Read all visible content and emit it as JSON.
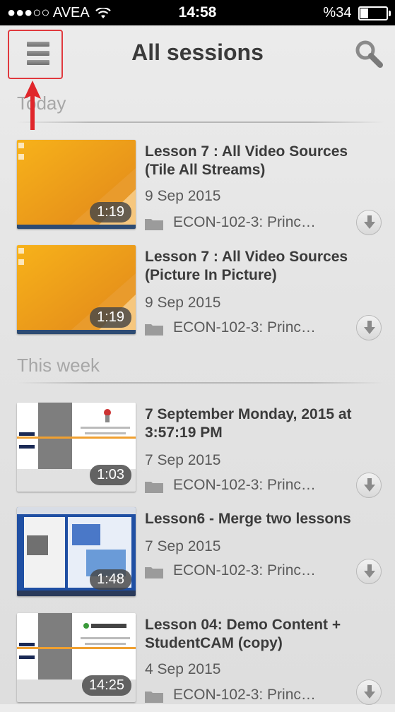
{
  "status_bar": {
    "carrier": "●●●○○ AVEA",
    "time": "14:58",
    "battery": "%34"
  },
  "nav": {
    "title": "All sessions"
  },
  "sections": [
    {
      "label": "Today"
    },
    {
      "label": "This week"
    }
  ],
  "sessions": [
    {
      "title": "Lesson 7 : All Video Sources (Tile All Streams)",
      "date": "9 Sep 2015",
      "course": "ECON-102-3: Princ…",
      "duration": "1:19"
    },
    {
      "title": "Lesson 7 : All Video Sources (Picture In Picture)",
      "date": "9 Sep 2015",
      "course": "ECON-102-3: Princ…",
      "duration": "1:19"
    },
    {
      "title": "7 September Monday,  2015 at 3:57:19 PM",
      "date": "7 Sep 2015",
      "course": "ECON-102-3: Princ…",
      "duration": "1:03"
    },
    {
      "title": "Lesson6 - Merge two lessons",
      "date": "7 Sep 2015",
      "course": "ECON-102-3: Princ…",
      "duration": "1:48"
    },
    {
      "title": "Lesson 04: Demo Content + StudentCAM (copy)",
      "date": "4 Sep 2015",
      "course": "ECON-102-3: Princ…",
      "duration": "14:25"
    }
  ],
  "colors": {
    "highlight": "#e0393e",
    "status_bg": "#000000"
  },
  "icons": [
    "menu-icon",
    "search-icon",
    "folder-icon",
    "download-icon",
    "wifi-icon",
    "battery-icon"
  ]
}
